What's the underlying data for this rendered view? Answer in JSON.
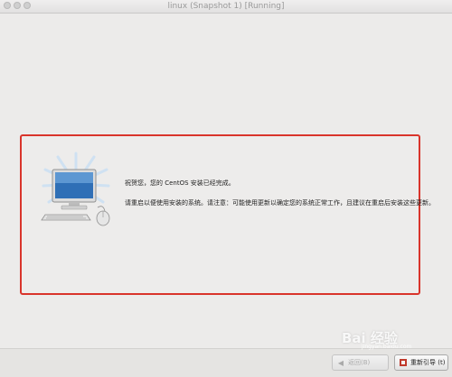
{
  "window": {
    "title": "linux (Snapshot 1) [Running]"
  },
  "dialog": {
    "line1": "祝贺您，您的 CentOS 安装已经完成。",
    "line2": "请重启以便使用安装的系统。请注意：可能使用更新以确定您的系统正常工作，且建议在重启后安装这些更新。",
    "illustration": "computer-icon"
  },
  "buttons": {
    "back": "返回(B)",
    "reboot": "重新引导 (t)"
  },
  "watermark": {
    "brand": "Bai 经验",
    "url": "jingyan.baidu.com"
  },
  "colors": {
    "highlight_border": "#d9342b",
    "background": "#ecebea"
  }
}
